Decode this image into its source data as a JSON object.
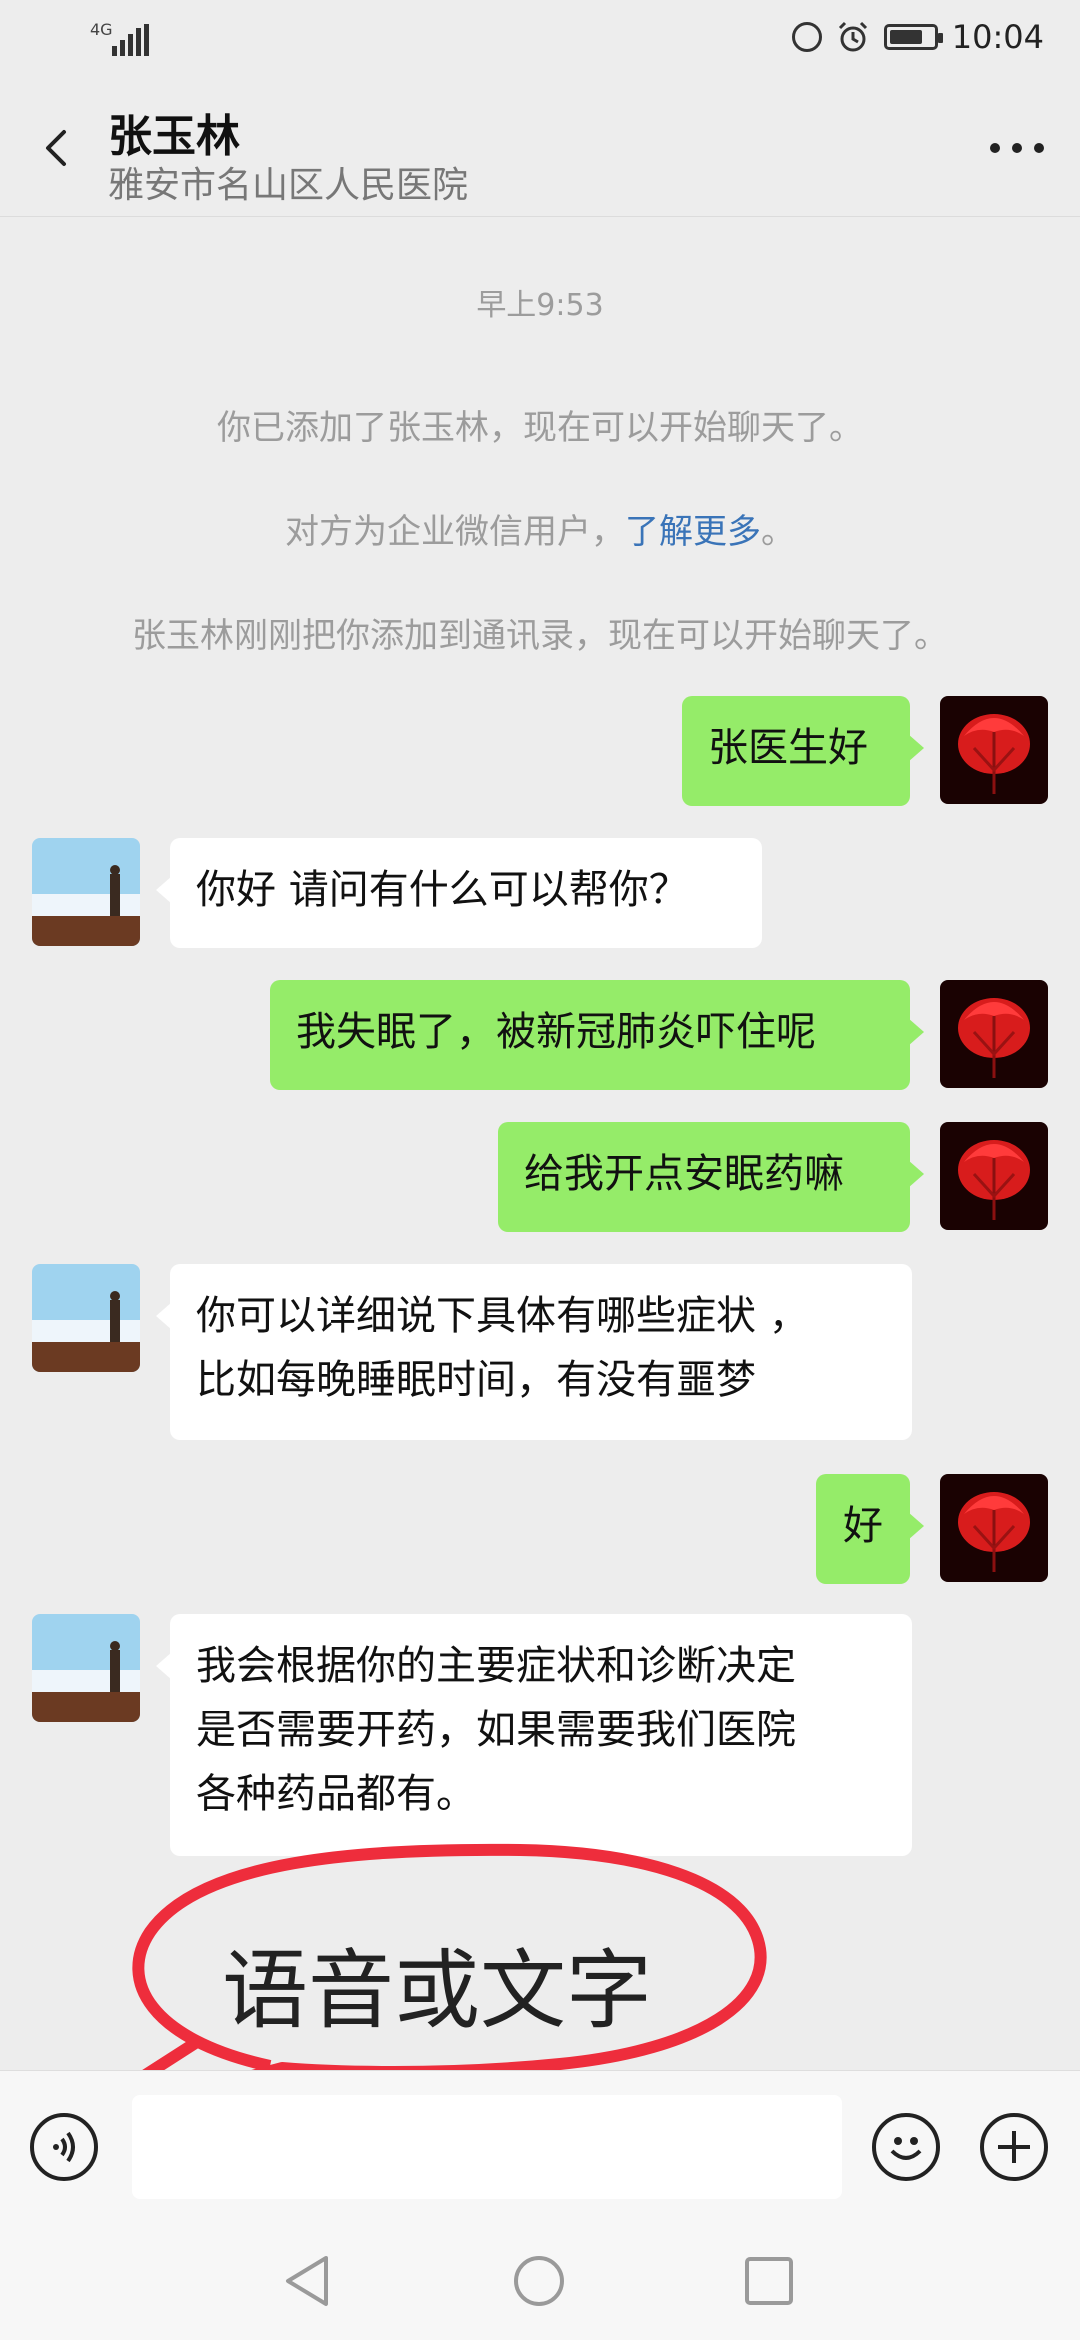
{
  "status_bar": {
    "network": "4G",
    "time": "10:04"
  },
  "header": {
    "contact_name": "张玉林",
    "contact_org": "雅安市名山区人民医院"
  },
  "system_messages": {
    "timestamp": "早上9:53",
    "added_notice": "你已添加了张玉林，现在可以开始聊天了。",
    "enterprise_prefix": "对方为企业微信用户，",
    "enterprise_link": "了解更多",
    "enterprise_suffix": "。",
    "contact_added_notice": "张玉林刚刚把你添加到通讯录，现在可以开始聊天了。"
  },
  "messages": [
    {
      "from": "me",
      "text": "张医生好"
    },
    {
      "from": "them",
      "text": "你好 请问有什么可以帮你？"
    },
    {
      "from": "me",
      "text": "我失眠了，被新冠肺炎吓住呢"
    },
    {
      "from": "me",
      "text": "给我开点安眠药嘛"
    },
    {
      "from": "them",
      "line1": "你可以详细说下具体有哪些症状 ，",
      "line2": "比如每晚睡眠时间，有没有噩梦"
    },
    {
      "from": "me",
      "text": "好"
    },
    {
      "from": "them",
      "line1": "我会根据你的主要症状和诊断决定",
      "line2": "是否需要开药，如果需要我们医院",
      "line3": "各种药品都有。"
    }
  ],
  "annotation": {
    "text": "语音或文字",
    "color": "#ee2d3c"
  },
  "input_bar": {
    "voice_icon": "voice-toggle-icon",
    "emoji_icon": "emoji-icon",
    "plus_icon": "plus-icon",
    "text_value": ""
  },
  "nav_bar": {
    "icons": [
      "back-triangle-icon",
      "home-circle-icon",
      "recents-square-icon"
    ]
  },
  "colors": {
    "my_bubble": "#95ec69",
    "their_bubble": "#ffffff",
    "background": "#ededed",
    "link": "#3a74b8"
  }
}
